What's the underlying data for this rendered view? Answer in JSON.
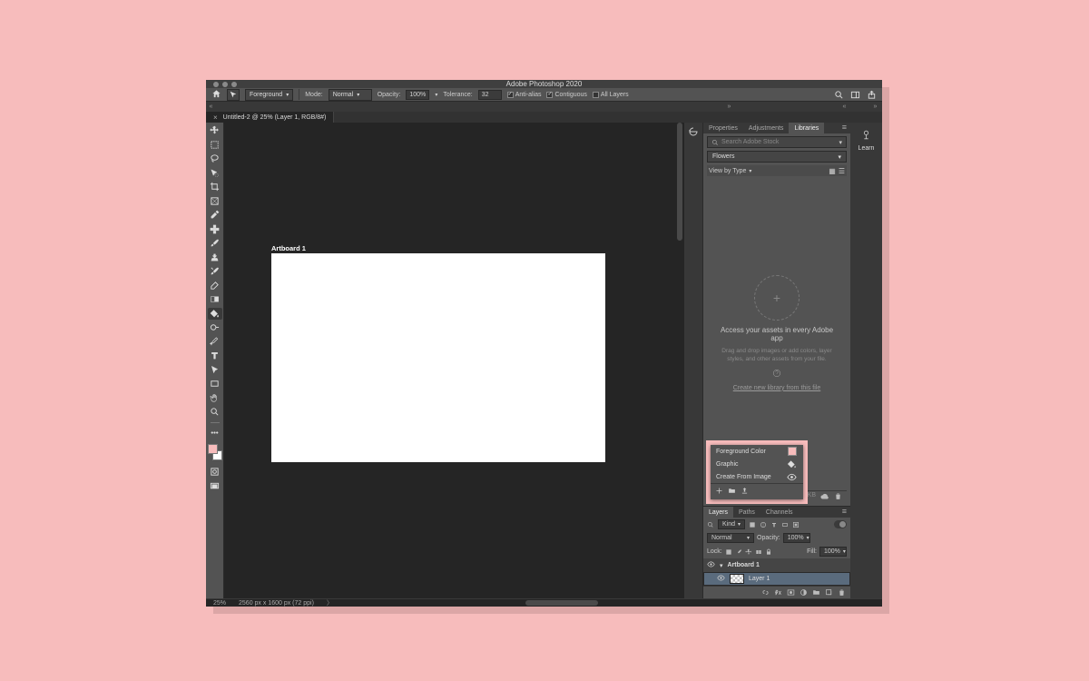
{
  "colors": {
    "page_bg": "#f7bcbc",
    "fg_swatch": "#f7bcbc"
  },
  "titlebar": {
    "title": "Adobe Photoshop 2020"
  },
  "optionsbar": {
    "fill_label": "Foreground",
    "mode_label": "Mode:",
    "mode_value": "Normal",
    "opacity_label": "Opacity:",
    "opacity_value": "100%",
    "tolerance_label": "Tolerance:",
    "tolerance_value": "32",
    "antialias_label": "Anti-alias",
    "contiguous_label": "Contiguous",
    "alllayers_label": "All Layers"
  },
  "tab": {
    "title": "Untitled-2 @ 25% (Layer 1, RGB/8#)"
  },
  "artboard": {
    "label": "Artboard 1"
  },
  "statusbar": {
    "zoom": "25%",
    "docinfo": "2560 px x 1600 px (72 ppi)"
  },
  "panels": {
    "properties": "Properties",
    "adjustments": "Adjustments",
    "libraries": "Libraries",
    "learn": "Learn",
    "search_placeholder": "Search Adobe Stock",
    "library_name": "Flowers",
    "view_by": "View by Type",
    "empty_heading": "Access your assets in every Adobe app",
    "empty_sub": "Drag and drop images or add colors, layer styles, and other assets from your file.",
    "create_link": "Create new library from this file",
    "foot_size": "-- KB"
  },
  "popup": {
    "items": [
      {
        "label": "Foreground Color",
        "icon": "swatch"
      },
      {
        "label": "Graphic",
        "icon": "bucket"
      },
      {
        "label": "Create From Image",
        "icon": "eye"
      }
    ]
  },
  "layers": {
    "tab_layers": "Layers",
    "tab_paths": "Paths",
    "tab_channels": "Channels",
    "kind_label": "Kind",
    "blend": "Normal",
    "opacity_label": "Opacity:",
    "opacity_value": "100%",
    "lock_label": "Lock:",
    "fill_label": "Fill:",
    "fill_value": "100%",
    "items": [
      {
        "name": "Artboard 1",
        "type": "artboard"
      },
      {
        "name": "Layer 1",
        "type": "layer",
        "selected": true
      }
    ]
  }
}
